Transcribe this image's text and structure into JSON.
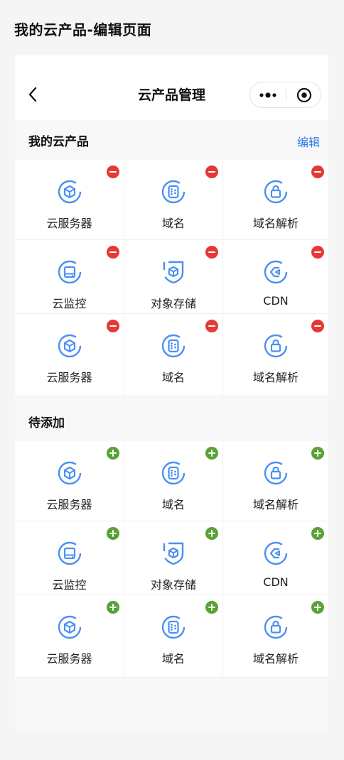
{
  "page_title": "我的云产品-编辑页面",
  "navbar": {
    "title": "云产品管理"
  },
  "my_products": {
    "label": "我的云产品",
    "edit_label": "编辑",
    "items": [
      {
        "name": "云服务器",
        "icon": "cloud-server-icon"
      },
      {
        "name": "域名",
        "icon": "domain-icon"
      },
      {
        "name": "域名解析",
        "icon": "dns-resolve-icon"
      },
      {
        "name": "云监控",
        "icon": "cloud-monitor-icon"
      },
      {
        "name": "对象存储",
        "icon": "object-storage-icon"
      },
      {
        "name": "CDN",
        "icon": "cdn-icon"
      },
      {
        "name": "云服务器",
        "icon": "cloud-server-icon"
      },
      {
        "name": "域名",
        "icon": "domain-icon"
      },
      {
        "name": "域名解析",
        "icon": "dns-resolve-icon"
      }
    ]
  },
  "to_add": {
    "label": "待添加",
    "items": [
      {
        "name": "云服务器",
        "icon": "cloud-server-icon"
      },
      {
        "name": "域名",
        "icon": "domain-icon"
      },
      {
        "name": "域名解析",
        "icon": "dns-resolve-icon"
      },
      {
        "name": "云监控",
        "icon": "cloud-monitor-icon"
      },
      {
        "name": "对象存储",
        "icon": "object-storage-icon"
      },
      {
        "name": "CDN",
        "icon": "cdn-icon"
      },
      {
        "name": "云服务器",
        "icon": "cloud-server-icon"
      },
      {
        "name": "域名",
        "icon": "domain-icon"
      },
      {
        "name": "域名解析",
        "icon": "dns-resolve-icon"
      }
    ]
  },
  "colors": {
    "accent": "#2f7ae5",
    "icon_blue": "#4a8ff5",
    "remove_badge": "#e53935",
    "add_badge": "#58a236"
  }
}
